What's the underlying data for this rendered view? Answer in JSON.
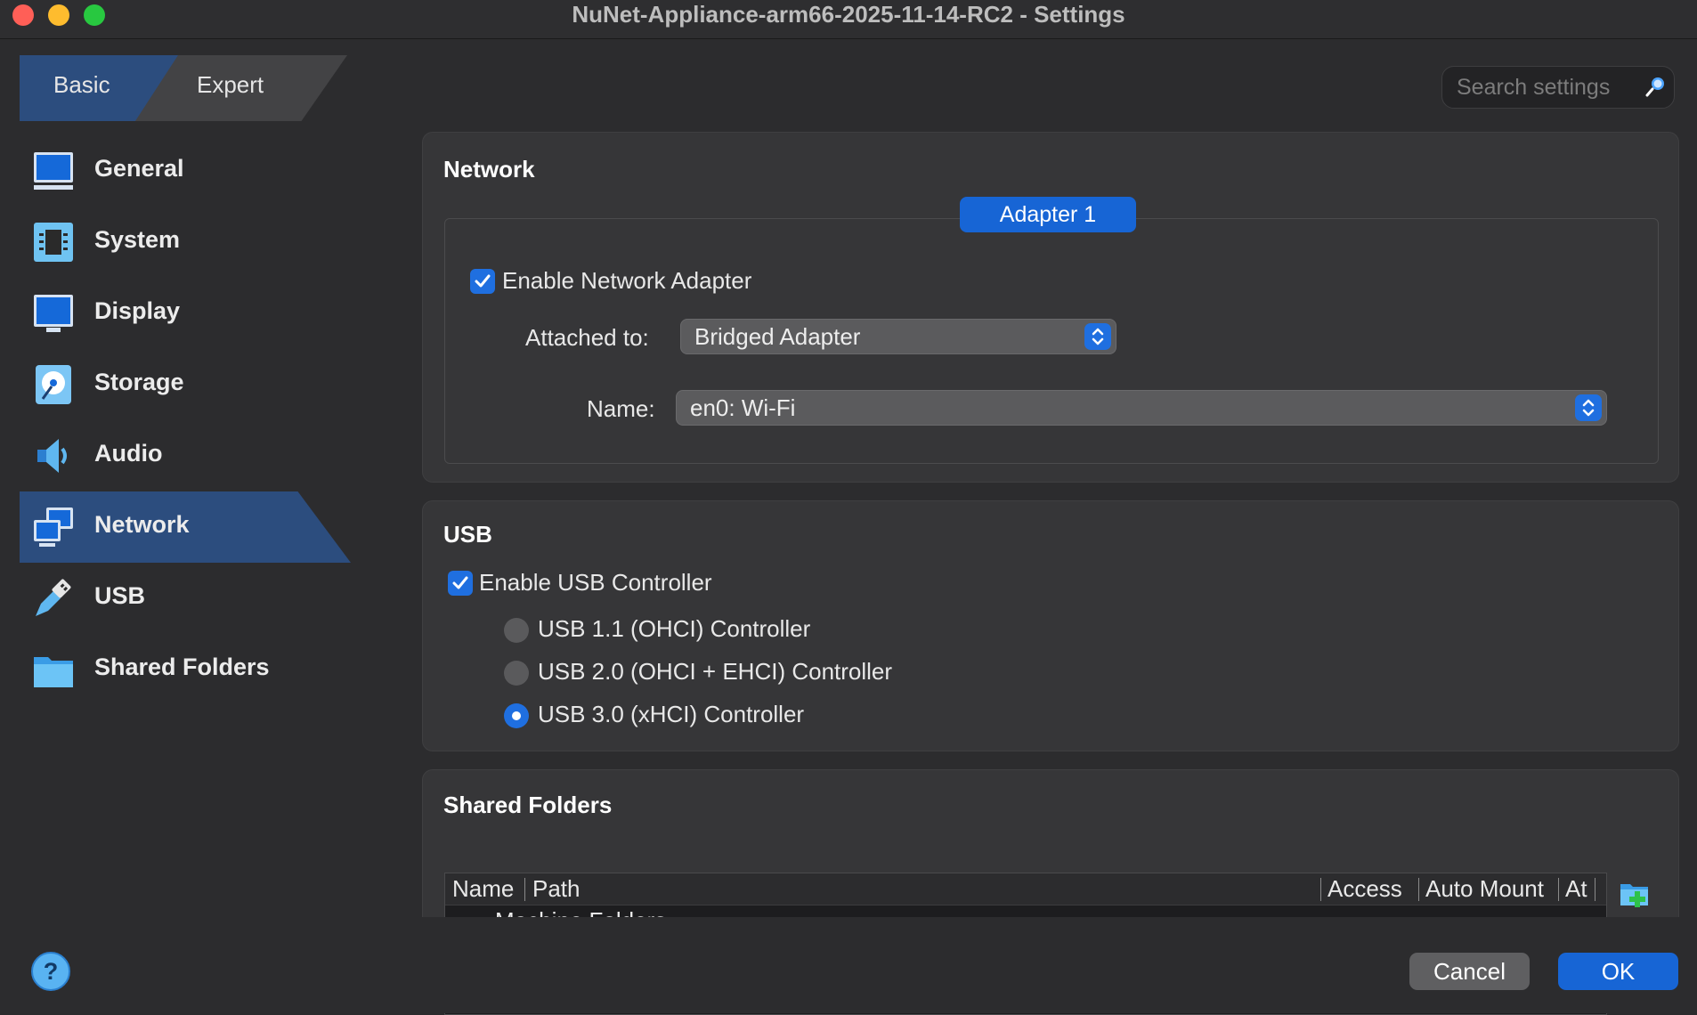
{
  "window": {
    "title": "NuNet-Appliance-arm66-2025-11-14-RC2 - Settings"
  },
  "mode_tabs": {
    "basic": "Basic",
    "expert": "Expert",
    "selected": "Basic"
  },
  "search": {
    "placeholder": "Search settings"
  },
  "sidebar": {
    "selected": "Network",
    "items": [
      {
        "label": "General",
        "icon": "general-icon"
      },
      {
        "label": "System",
        "icon": "system-icon"
      },
      {
        "label": "Display",
        "icon": "display-icon"
      },
      {
        "label": "Storage",
        "icon": "storage-icon"
      },
      {
        "label": "Audio",
        "icon": "audio-icon"
      },
      {
        "label": "Network",
        "icon": "network-icon"
      },
      {
        "label": "USB",
        "icon": "usb-icon"
      },
      {
        "label": "Shared Folders",
        "icon": "shared-folders-icon"
      }
    ]
  },
  "network": {
    "title": "Network",
    "adapter_tab": "Adapter 1",
    "enable_label": "Enable Network Adapter",
    "enabled": true,
    "attached_label": "Attached to:",
    "attached_value": "Bridged Adapter",
    "name_label": "Name:",
    "name_value": "en0: Wi-Fi"
  },
  "usb": {
    "title": "USB",
    "enable_label": "Enable USB Controller",
    "enabled": true,
    "controllers": [
      {
        "label": "USB 1.1 (OHCI) Controller",
        "selected": false
      },
      {
        "label": "USB 2.0 (OHCI + EHCI) Controller",
        "selected": false
      },
      {
        "label": "USB 3.0 (xHCI) Controller",
        "selected": true
      }
    ]
  },
  "shared_folders": {
    "title": "Shared Folders",
    "columns": [
      "Name",
      "Path",
      "Access",
      "Auto Mount",
      "At"
    ],
    "rows": [
      "Machine Folders"
    ]
  },
  "footer": {
    "cancel": "Cancel",
    "ok": "OK"
  },
  "colors": {
    "accent": "#1765d5",
    "selection": "#2c4d7e"
  }
}
